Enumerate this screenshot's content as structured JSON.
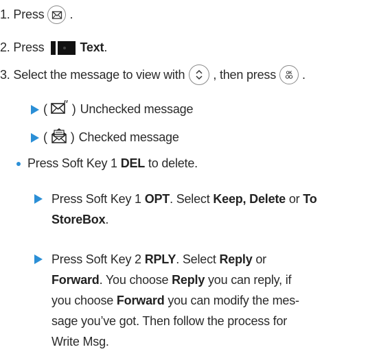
{
  "steps": {
    "step1": {
      "prefix": "1. Press",
      "suffix": "."
    },
    "step2": {
      "prefix": "2. Press",
      "bold": "Text",
      "suffix": "."
    },
    "step3": {
      "prefix": "3. Select the message to view with",
      "middle": ", then press",
      "suffix": "."
    }
  },
  "icons": {
    "step1_key": "message-envelope-key-icon",
    "step2_key": "soft-key-black-icon",
    "step3_nav": "navigation-key-icon",
    "step3_ok": "ok-key-icon",
    "unchecked": "unchecked-message-envelope-icon",
    "checked": "checked-message-envelope-icon"
  },
  "status": {
    "unchecked": {
      "open": "(",
      "close": ")",
      "label": "Unchecked message"
    },
    "checked": {
      "open": "(",
      "close": ")",
      "label": "Checked message"
    }
  },
  "bullet": {
    "prefix": "Press Soft Key 1",
    "bold": "DEL",
    "suffix": "to delete."
  },
  "opt": {
    "prefix": "Press Soft Key 1",
    "bold1": "OPT",
    "middle": ". Select",
    "bold2": "Keep, Delete",
    "or": "or",
    "bold3_line1": "To",
    "bold3_line2": "StoreBox",
    "end": "."
  },
  "rply": {
    "prefix": "Press Soft Key 2",
    "bold1": "RPLY",
    "middle1": ". Select",
    "bold2": "Reply",
    "or": "or",
    "bold3": "Forward",
    "middle2": ". You choose",
    "bold4": "Reply",
    "middle3": "you can reply, if",
    "line3_prefix": "you choose",
    "bold5": "Forward",
    "middle4": "you can modify the mes-",
    "line4": "sage you’ve got. Then follow the process for",
    "line5": "Write Msg."
  },
  "colors": {
    "accent": "#2b8fd6",
    "text": "#2a2a2a"
  }
}
